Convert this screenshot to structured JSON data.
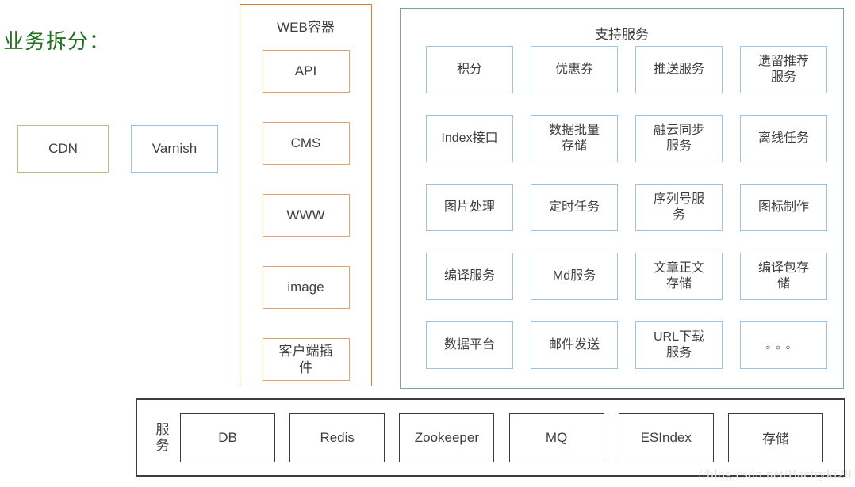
{
  "title": "业务拆分：",
  "title_color": "#227022",
  "edge_nodes": [
    {
      "label": "CDN",
      "border_color": "#a9c47f"
    },
    {
      "label": "Varnish",
      "border_color": "#9dc3e6"
    }
  ],
  "web_container": {
    "title": "WEB容器",
    "border_color": "#e07b33",
    "item_border_color": "#e8a06a",
    "items": [
      {
        "label": "API"
      },
      {
        "label": "CMS"
      },
      {
        "label": "WWW"
      },
      {
        "label": "image"
      },
      {
        "label": "客户端插\n件"
      }
    ]
  },
  "support_services": {
    "title": "支持服务",
    "border_color": "#7d9fb5",
    "item_border_color": "#9dc3e6",
    "items": [
      {
        "label": "积分"
      },
      {
        "label": "优惠券"
      },
      {
        "label": "推送服务"
      },
      {
        "label": "遗留推荐\n服务"
      },
      {
        "label": "Index接口"
      },
      {
        "label": "数据批量\n存储"
      },
      {
        "label": "融云同步\n服务"
      },
      {
        "label": "离线任务"
      },
      {
        "label": "图片处理"
      },
      {
        "label": "定时任务"
      },
      {
        "label": "序列号服\n务"
      },
      {
        "label": "图标制作"
      },
      {
        "label": "编译服务"
      },
      {
        "label": "Md服务"
      },
      {
        "label": "文章正文\n存储"
      },
      {
        "label": "编译包存\n储"
      },
      {
        "label": "数据平台"
      },
      {
        "label": "邮件发送"
      },
      {
        "label": "URL下载\n服务"
      },
      {
        "label": "。。。"
      }
    ]
  },
  "infrastructure": {
    "label": "服\n务",
    "border_color": "#3c3c3c",
    "items": [
      {
        "label": "DB"
      },
      {
        "label": "Redis"
      },
      {
        "label": "Zookeeper"
      },
      {
        "label": "MQ"
      },
      {
        "label": "ESIndex"
      },
      {
        "label": "存储"
      }
    ]
  },
  "watermark": "//blog.csdn.net/Bactryki28"
}
